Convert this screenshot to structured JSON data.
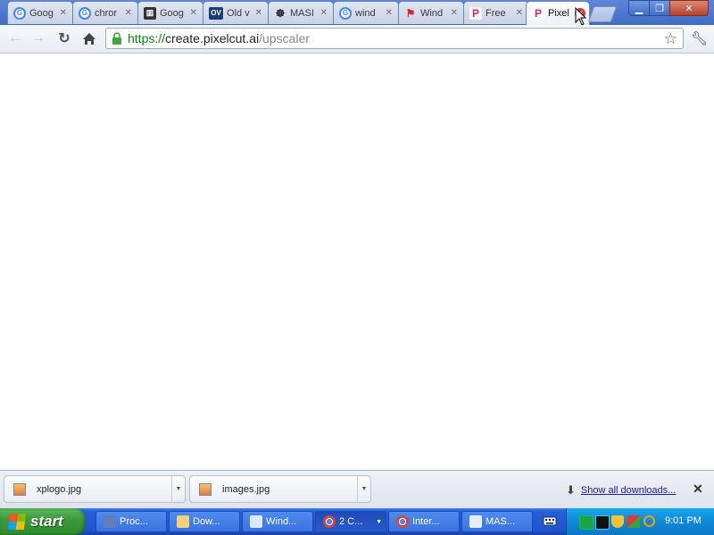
{
  "browser": {
    "tabs": [
      {
        "title": "Goog",
        "favicon": "google-icon"
      },
      {
        "title": "chror",
        "favicon": "google-icon"
      },
      {
        "title": "Goog",
        "favicon": "archive-icon"
      },
      {
        "title": "Old v",
        "favicon": "ov-icon",
        "favicon_text": "OV"
      },
      {
        "title": "MASI",
        "favicon": "mas-icon"
      },
      {
        "title": "wind",
        "favicon": "google-icon"
      },
      {
        "title": "Wind",
        "favicon": "windows-flag-icon"
      },
      {
        "title": "Free",
        "favicon": "pixelcut-icon",
        "favicon_text": "P"
      },
      {
        "title": "Pixel",
        "favicon": "pixelcut-icon",
        "favicon_text": "P",
        "active": true
      }
    ],
    "url": {
      "scheme": "https://",
      "host": "create.pixelcut.ai",
      "path": "/upscaler"
    },
    "window_controls": [
      "minimize",
      "restore",
      "close"
    ]
  },
  "downloads": {
    "items": [
      {
        "name": "xplogo.jpg"
      },
      {
        "name": "images.jpg"
      }
    ],
    "show_all_label": "Show all downloads..."
  },
  "taskbar": {
    "start_label": "start",
    "tasks": [
      {
        "label": "Proc...",
        "icon": "monitor-icon"
      },
      {
        "label": "Dow...",
        "icon": "folder-icon"
      },
      {
        "label": "Wind...",
        "icon": "window-icon"
      },
      {
        "label": "2 C...",
        "icon": "chrome-icon",
        "pressed": true
      },
      {
        "label": "Inter...",
        "icon": "chrome-icon"
      },
      {
        "label": "MAS...",
        "icon": "mas-icon"
      }
    ],
    "clock": "9:01 PM"
  },
  "colors": {
    "xp_taskbar_blue": "#245edb",
    "start_green": "#3c9b3c",
    "tray_blue": "#0f8ad8",
    "url_scheme_green": "#0a8a0a"
  }
}
